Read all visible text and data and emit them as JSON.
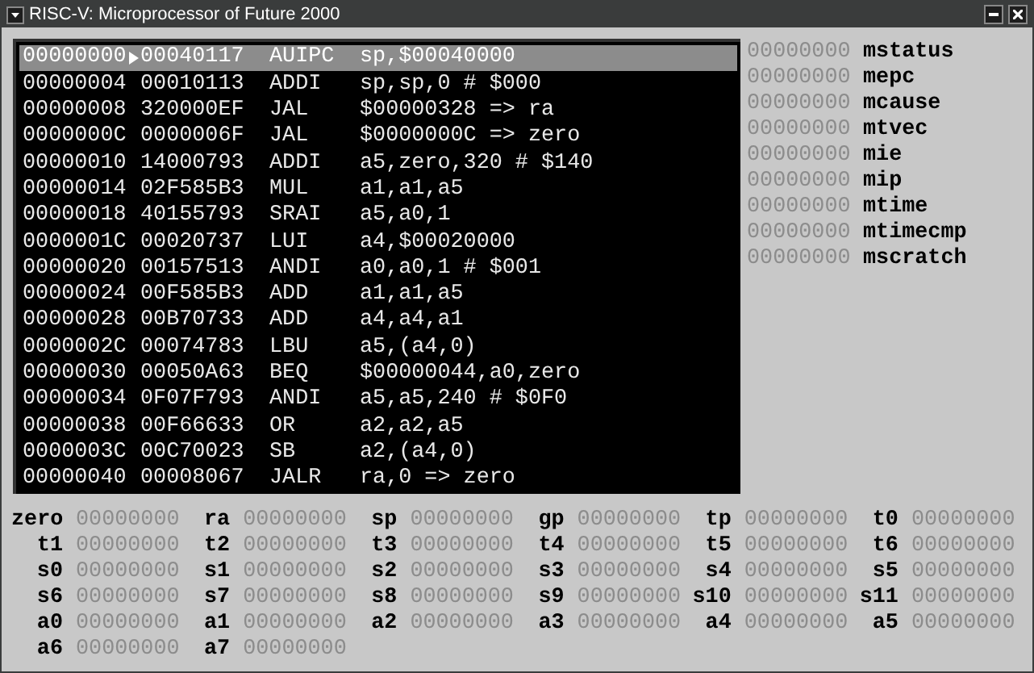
{
  "window": {
    "title": "RISC-V: Microprocessor of Future 2000"
  },
  "listing": [
    {
      "address": "00000000",
      "code": "00040117",
      "mnemonic": "AUIPC",
      "operands": "sp,$00040000",
      "selected": true
    },
    {
      "address": "00000004",
      "code": "00010113",
      "mnemonic": "ADDI",
      "operands": "sp,sp,0 # $000",
      "selected": false
    },
    {
      "address": "00000008",
      "code": "320000EF",
      "mnemonic": "JAL",
      "operands": "$00000328 => ra",
      "selected": false
    },
    {
      "address": "0000000C",
      "code": "0000006F",
      "mnemonic": "JAL",
      "operands": "$0000000C => zero",
      "selected": false
    },
    {
      "address": "00000010",
      "code": "14000793",
      "mnemonic": "ADDI",
      "operands": "a5,zero,320 # $140",
      "selected": false
    },
    {
      "address": "00000014",
      "code": "02F585B3",
      "mnemonic": "MUL",
      "operands": "a1,a1,a5",
      "selected": false
    },
    {
      "address": "00000018",
      "code": "40155793",
      "mnemonic": "SRAI",
      "operands": "a5,a0,1",
      "selected": false
    },
    {
      "address": "0000001C",
      "code": "00020737",
      "mnemonic": "LUI",
      "operands": "a4,$00020000",
      "selected": false
    },
    {
      "address": "00000020",
      "code": "00157513",
      "mnemonic": "ANDI",
      "operands": "a0,a0,1 # $001",
      "selected": false
    },
    {
      "address": "00000024",
      "code": "00F585B3",
      "mnemonic": "ADD",
      "operands": "a1,a1,a5",
      "selected": false
    },
    {
      "address": "00000028",
      "code": "00B70733",
      "mnemonic": "ADD",
      "operands": "a4,a4,a1",
      "selected": false
    },
    {
      "address": "0000002C",
      "code": "00074783",
      "mnemonic": "LBU",
      "operands": "a5,(a4,0)",
      "selected": false
    },
    {
      "address": "00000030",
      "code": "00050A63",
      "mnemonic": "BEQ",
      "operands": "$00000044,a0,zero",
      "selected": false
    },
    {
      "address": "00000034",
      "code": "0F07F793",
      "mnemonic": "ANDI",
      "operands": "a5,a5,240 # $0F0",
      "selected": false
    },
    {
      "address": "00000038",
      "code": "00F66633",
      "mnemonic": "OR",
      "operands": "a2,a2,a5",
      "selected": false
    },
    {
      "address": "0000003C",
      "code": "00C70023",
      "mnemonic": "SB",
      "operands": "a2,(a4,0)",
      "selected": false
    },
    {
      "address": "00000040",
      "code": "00008067",
      "mnemonic": "JALR",
      "operands": "ra,0 => zero",
      "selected": false
    }
  ],
  "csr_registers": [
    {
      "value": "00000000",
      "name": "mstatus"
    },
    {
      "value": "00000000",
      "name": "mepc"
    },
    {
      "value": "00000000",
      "name": "mcause"
    },
    {
      "value": "00000000",
      "name": "mtvec"
    },
    {
      "value": "00000000",
      "name": "mie"
    },
    {
      "value": "00000000",
      "name": "mip"
    },
    {
      "value": "00000000",
      "name": "mtime"
    },
    {
      "value": "00000000",
      "name": "mtimecmp"
    },
    {
      "value": "00000000",
      "name": "mscratch"
    }
  ],
  "registers": [
    {
      "name": "zero",
      "value": "00000000"
    },
    {
      "name": "ra",
      "value": "00000000"
    },
    {
      "name": "sp",
      "value": "00000000"
    },
    {
      "name": "gp",
      "value": "00000000"
    },
    {
      "name": "tp",
      "value": "00000000"
    },
    {
      "name": "t0",
      "value": "00000000"
    },
    {
      "name": "t1",
      "value": "00000000"
    },
    {
      "name": "t2",
      "value": "00000000"
    },
    {
      "name": "t3",
      "value": "00000000"
    },
    {
      "name": "t4",
      "value": "00000000"
    },
    {
      "name": "t5",
      "value": "00000000"
    },
    {
      "name": "t6",
      "value": "00000000"
    },
    {
      "name": "s0",
      "value": "00000000"
    },
    {
      "name": "s1",
      "value": "00000000"
    },
    {
      "name": "s2",
      "value": "00000000"
    },
    {
      "name": "s3",
      "value": "00000000"
    },
    {
      "name": "s4",
      "value": "00000000"
    },
    {
      "name": "s5",
      "value": "00000000"
    },
    {
      "name": "s6",
      "value": "00000000"
    },
    {
      "name": "s7",
      "value": "00000000"
    },
    {
      "name": "s8",
      "value": "00000000"
    },
    {
      "name": "s9",
      "value": "00000000"
    },
    {
      "name": "s10",
      "value": "00000000"
    },
    {
      "name": "s11",
      "value": "00000000"
    },
    {
      "name": "a0",
      "value": "00000000"
    },
    {
      "name": "a1",
      "value": "00000000"
    },
    {
      "name": "a2",
      "value": "00000000"
    },
    {
      "name": "a3",
      "value": "00000000"
    },
    {
      "name": "a4",
      "value": "00000000"
    },
    {
      "name": "a5",
      "value": "00000000"
    },
    {
      "name": "a6",
      "value": "00000000"
    },
    {
      "name": "a7",
      "value": "00000000"
    }
  ]
}
